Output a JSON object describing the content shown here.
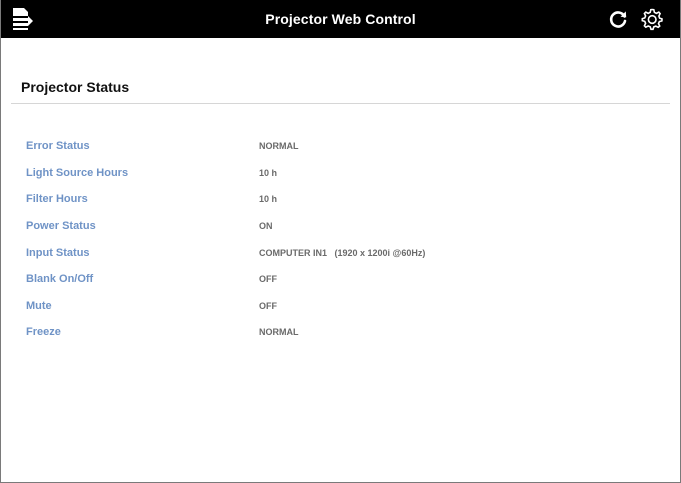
{
  "header": {
    "title": "Projector Web Control",
    "menu_icon": "menu-icon",
    "refresh_icon": "refresh-icon",
    "settings_icon": "gear-icon"
  },
  "main": {
    "section_title": "Projector Status",
    "rows": [
      {
        "label": "Error Status",
        "value": "NORMAL"
      },
      {
        "label": "Light Source Hours",
        "value": "10 h"
      },
      {
        "label": "Filter Hours",
        "value": "10 h"
      },
      {
        "label": "Power Status",
        "value": "ON"
      },
      {
        "label": "Input Status",
        "value": "COMPUTER IN1   (1920 x 1200i @60Hz)"
      },
      {
        "label": "Blank On/Off",
        "value": "OFF"
      },
      {
        "label": "Mute",
        "value": "OFF"
      },
      {
        "label": "Freeze",
        "value": "NORMAL"
      }
    ]
  },
  "colors": {
    "header_bg": "#000000",
    "label_text": "#6f93c6",
    "value_text": "#6a6a6a"
  }
}
